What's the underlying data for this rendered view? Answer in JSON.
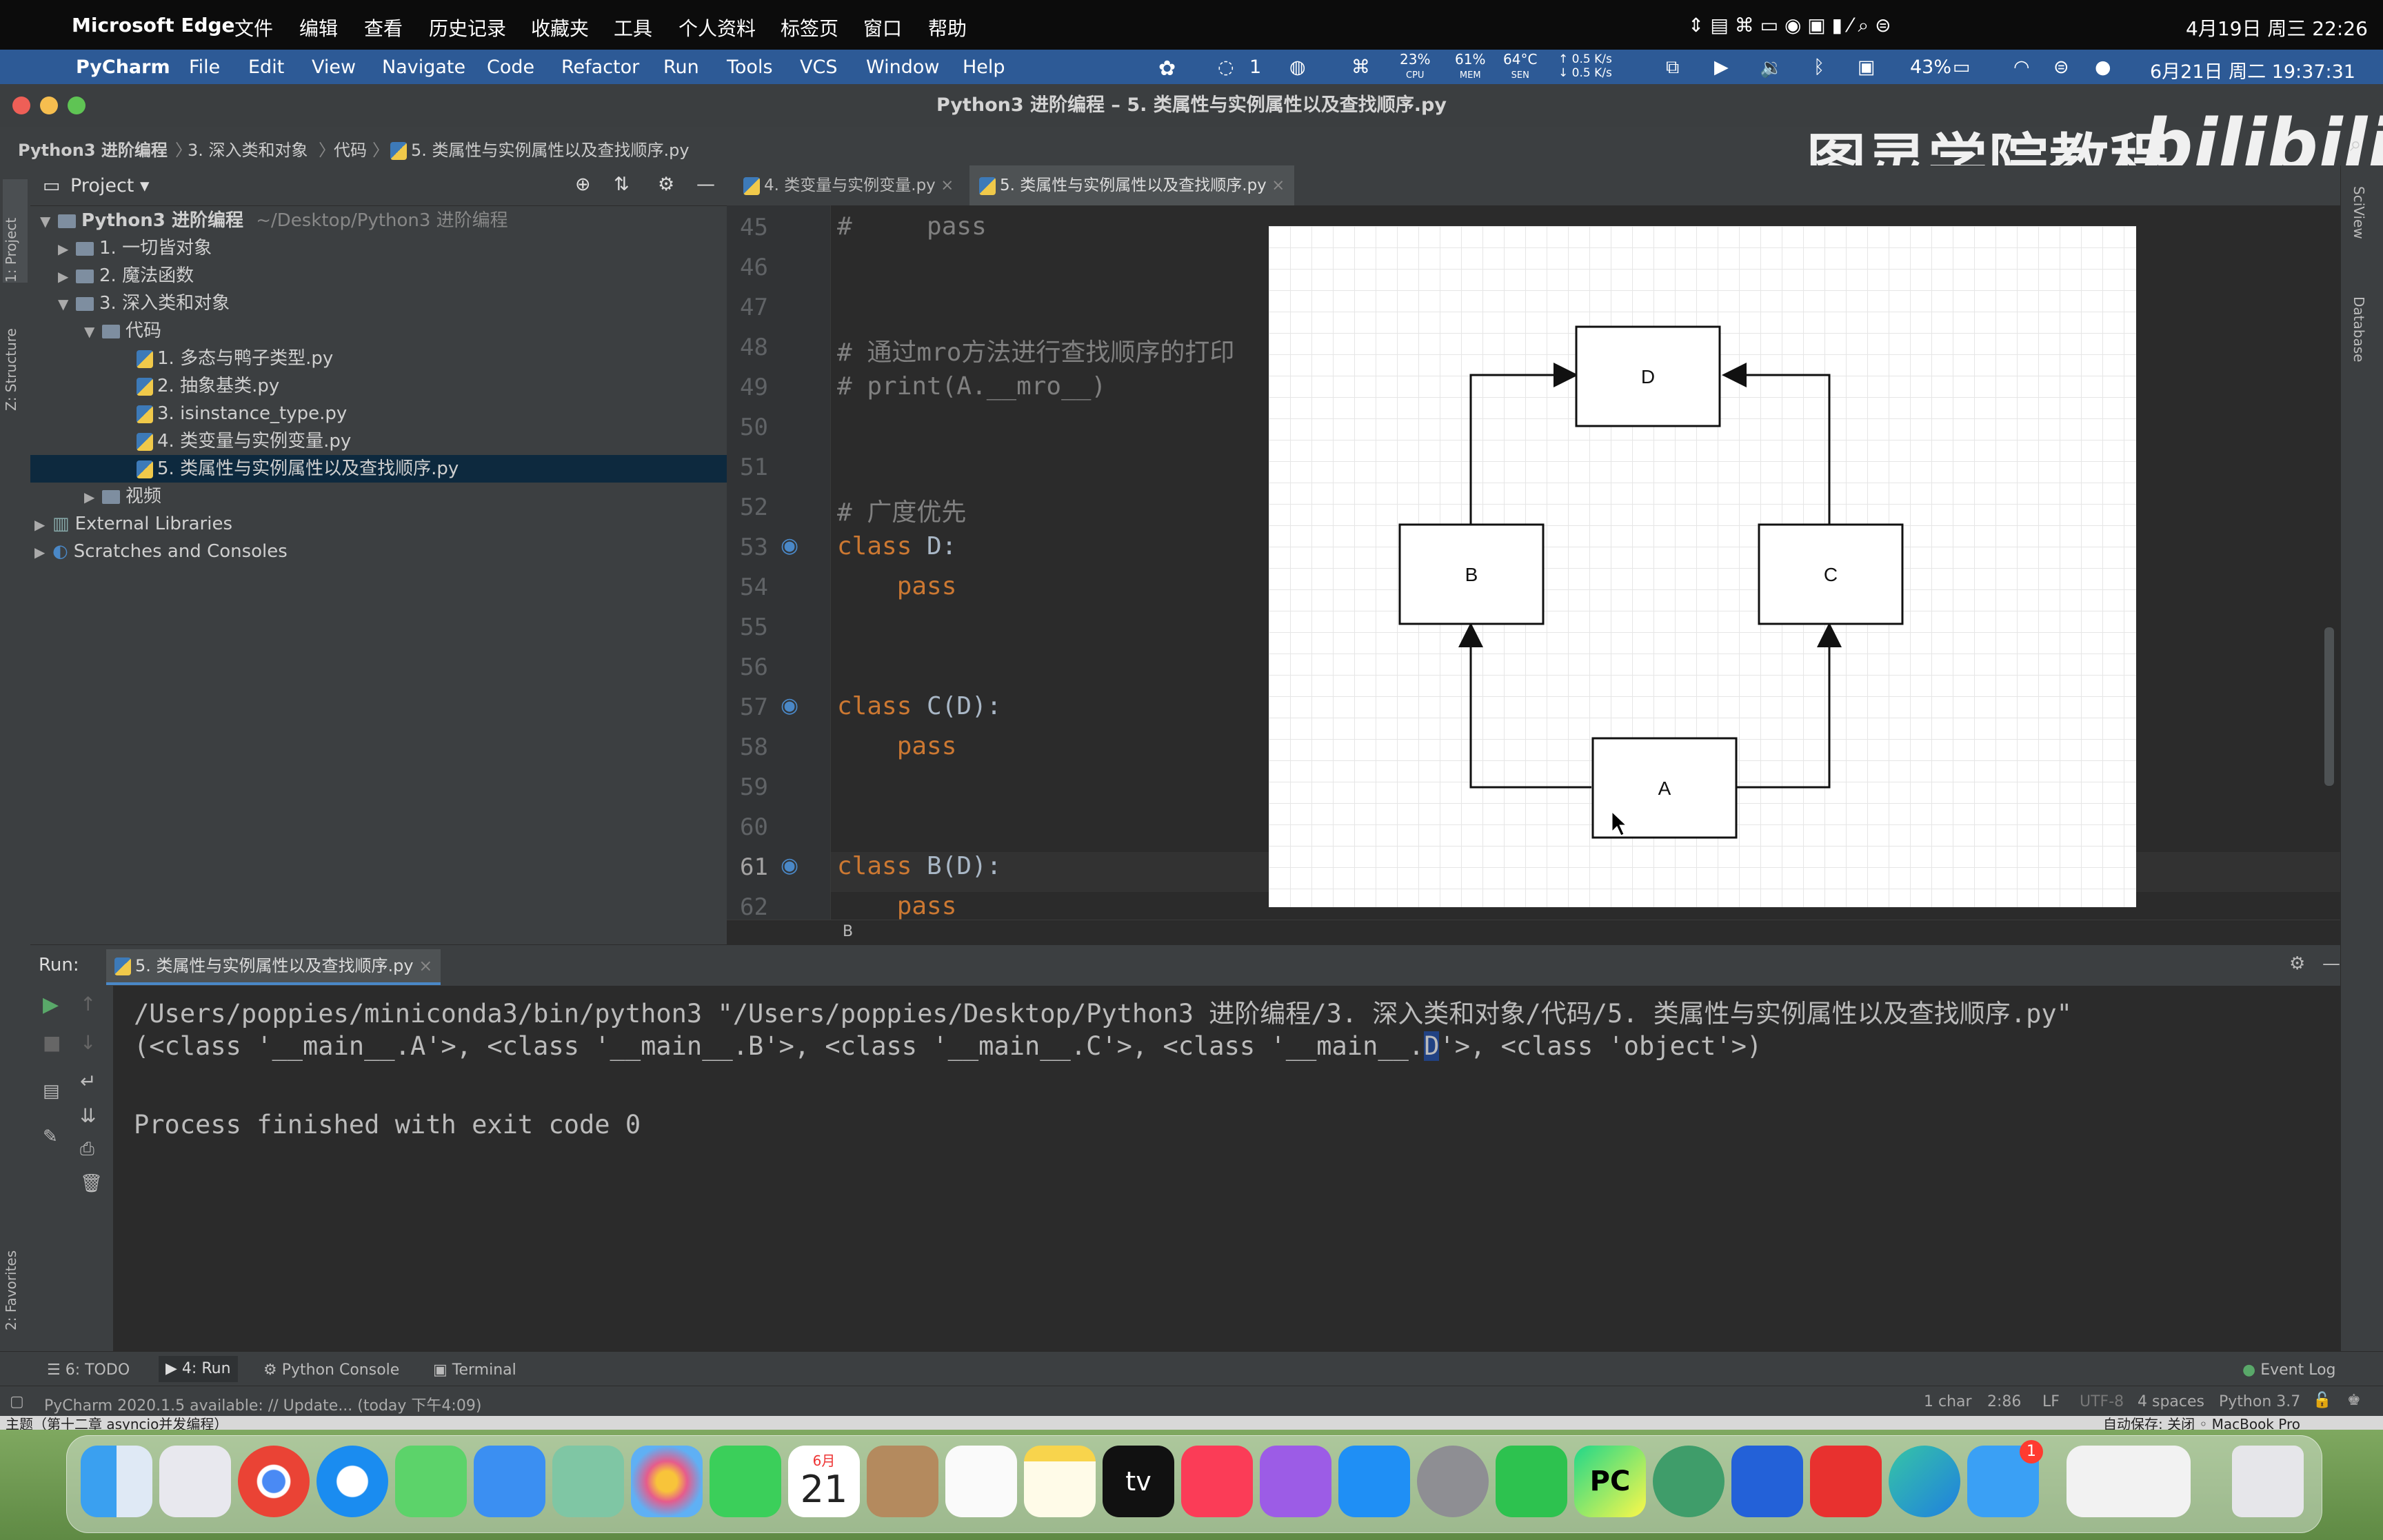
{
  "outer_menubar": {
    "app": "Microsoft Edge",
    "items": [
      "文件",
      "编辑",
      "查看",
      "历史记录",
      "收藏夹",
      "工具",
      "个人资料",
      "标签页",
      "窗口",
      "帮助"
    ],
    "datetime": "4月19日 周三 22:26"
  },
  "inner_menubar": {
    "app": "PyCharm",
    "items": [
      "File",
      "Edit",
      "View",
      "Navigate",
      "Code",
      "Refactor",
      "Run",
      "Tools",
      "VCS",
      "Window",
      "Help"
    ],
    "notifications": "1",
    "cpu": "23%",
    "cpu_label": "CPU",
    "mem": "61%",
    "mem_label": "MEM",
    "temp": "64°C",
    "temp_label": "SEN",
    "net_up": "0.5 K/s",
    "net_down": "0.5 K/s",
    "battery": "43%",
    "datetime": "6月21日 周二 19:37:31"
  },
  "titlebar": {
    "title": "Python3 进阶编程 – 5. 类属性与实例属性以及查找顺序.py"
  },
  "breadcrumb": [
    "Python3 进阶编程",
    "3. 深入类和对象",
    "代码",
    "5. 类属性与实例属性以及查找顺序.py"
  ],
  "watermark": {
    "text": "图灵学院教程",
    "logo": "bilibili"
  },
  "left_strip": {
    "project_tab": "1: Project",
    "structure_tab": "Z: Structure",
    "favorites_tab": "2: Favorites"
  },
  "right_strip": {
    "sciview": "SciView",
    "database": "Database"
  },
  "project": {
    "header": "Project",
    "root": "Python3 进阶编程",
    "root_path": "~/Desktop/Python3 进阶编程",
    "items": [
      {
        "label": "1. 一切皆对象"
      },
      {
        "label": "2. 魔法函数"
      },
      {
        "label": "3. 深入类和对象"
      },
      {
        "label": "代码"
      },
      {
        "label": "1. 多态与鸭子类型.py"
      },
      {
        "label": "2. 抽象基类.py"
      },
      {
        "label": "3. isinstance_type.py"
      },
      {
        "label": "4. 类变量与实例变量.py"
      },
      {
        "label": "5. 类属性与实例属性以及查找顺序.py"
      },
      {
        "label": "视频"
      },
      {
        "label": "External Libraries"
      },
      {
        "label": "Scratches and Consoles"
      }
    ]
  },
  "editor_tabs": [
    {
      "label": "4. 类变量与实例变量.py"
    },
    {
      "label": "5. 类属性与实例属性以及查找顺序.py"
    }
  ],
  "editor": {
    "line_numbers": [
      "45",
      "46",
      "47",
      "48",
      "49",
      "50",
      "51",
      "52",
      "53",
      "54",
      "55",
      "56",
      "57",
      "58",
      "59",
      "60",
      "61",
      "62"
    ],
    "lines": {
      "l45": "#     pass",
      "l48": "# 通过mro方法进行查找顺序的打印",
      "l49": "# print(A.__mro__)",
      "l52": "# 广度优先",
      "l53_kw": "class",
      "l53_name": " D:",
      "l54": "    pass",
      "l57_kw": "class",
      "l57_name": " C(D):",
      "l58": "    pass",
      "l61_kw": "class",
      "l61_name": " B(D):",
      "l62": "    pass"
    },
    "breadcrumb": "B"
  },
  "diagram": {
    "nodes": {
      "D": "D",
      "B": "B",
      "C": "C",
      "A": "A"
    }
  },
  "run": {
    "label": "Run:",
    "tab": "5. 类属性与实例属性以及查找顺序.py",
    "line1": "/Users/poppies/miniconda3/bin/python3 \"/Users/poppies/Desktop/Python3 进阶编程/3. 深入类和对象/代码/5. 类属性与实例属性以及查找顺序.py\"",
    "line2_pre": "(<class '__main__.A'>, <class '__main__.B'>, <class '__main__.C'>, <class '__main__.",
    "line2_hl": "D",
    "line2_post": "'>, <class 'object'>)",
    "line3": "Process finished with exit code 0"
  },
  "bottom_tools": {
    "todo": "6: TODO",
    "run": "4: Run",
    "python_console": "Python Console",
    "terminal": "Terminal",
    "event_log": "Event Log"
  },
  "status": {
    "message": "PyCharm 2020.1.5 available: // Update... (today 下午4:09)",
    "chars": "1 char",
    "pos": "2:86",
    "lf": "LF",
    "enc": "UTF-8",
    "indent": "4 spaces",
    "interp": "Python 3.7"
  },
  "behind": {
    "left": "主题（第十二章 asyncio并发编程）",
    "right": "自动保存: 关闭   ◦ MacBook Pro"
  },
  "dock": {
    "apps": [
      "finder",
      "launchpad",
      "chrome",
      "safari",
      "messages",
      "mail",
      "maps",
      "photos",
      "facetime",
      "calendar",
      "contacts",
      "reminders",
      "notes",
      "appletv",
      "music",
      "podcasts",
      "appstore",
      "settings",
      "wechat",
      "pycharm",
      "atom",
      "zoom",
      "xmind",
      "edge",
      "qq",
      "preview",
      "trash"
    ],
    "calendar_month": "6月",
    "calendar_day": "21",
    "qq_badge": "1"
  },
  "colors": {
    "accent": "#4a88c7",
    "keyword": "#cc7832",
    "comment": "#808080"
  }
}
